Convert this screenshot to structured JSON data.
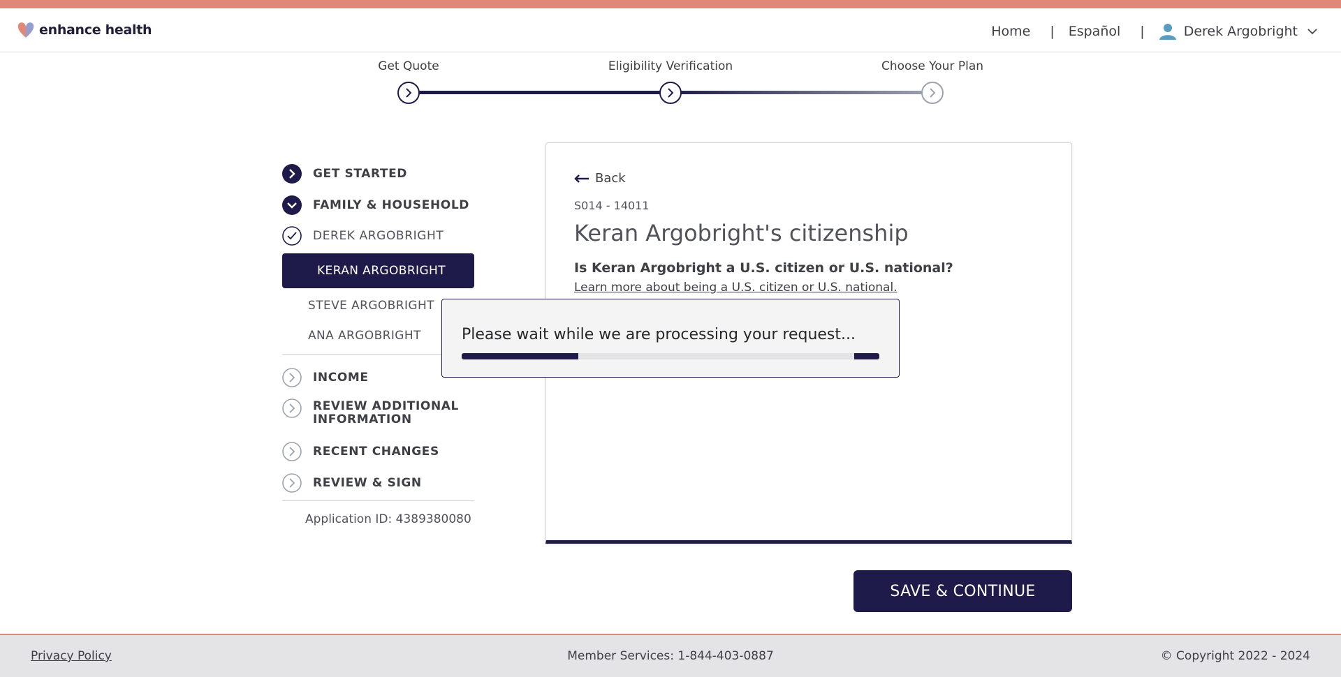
{
  "header": {
    "brand": "enhance health",
    "nav_home": "Home",
    "nav_separator": "|",
    "nav_language": "Español",
    "user_name": "Derek Argobright"
  },
  "stepper": {
    "steps": [
      {
        "label": "Get Quote",
        "state": "complete"
      },
      {
        "label": "Eligibility Verification",
        "state": "current"
      },
      {
        "label": "Choose Your Plan",
        "state": "upcoming"
      }
    ]
  },
  "sidebar": {
    "get_started": "GET STARTED",
    "family_household": "FAMILY & HOUSEHOLD",
    "member_complete": "DEREK ARGOBRIGHT",
    "member_active": "KERAN ARGOBRIGHT",
    "member_3": "STEVE ARGOBRIGHT",
    "member_4": "ANA ARGOBRIGHT",
    "income": "INCOME",
    "review_additional_1": "REVIEW ADDITIONAL",
    "review_additional_2": "INFORMATION",
    "recent_changes": "RECENT CHANGES",
    "review_sign": "REVIEW & SIGN",
    "application_id": "Application ID: 4389380080"
  },
  "card": {
    "back_label": "Back",
    "screen_id": "S014 - 14011",
    "title": "Keran Argobright's citizenship",
    "question": "Is Keran Argobright a U.S. citizen or U.S. national?",
    "learn_more": "Learn more about being a U.S. citizen or U.S. national."
  },
  "modal": {
    "message": "Please wait while we are processing your request...",
    "progress": 0.28
  },
  "actions": {
    "save_continue": "SAVE & CONTINUE"
  },
  "footer": {
    "privacy": "Privacy Policy",
    "member_services": "Member Services: 1-844-403-0887",
    "copyright": "© Copyright 2022 - 2024"
  },
  "colors": {
    "accent": "#e08978",
    "primary": "#1e1b4b",
    "footer_bg": "#e4e4e7"
  }
}
